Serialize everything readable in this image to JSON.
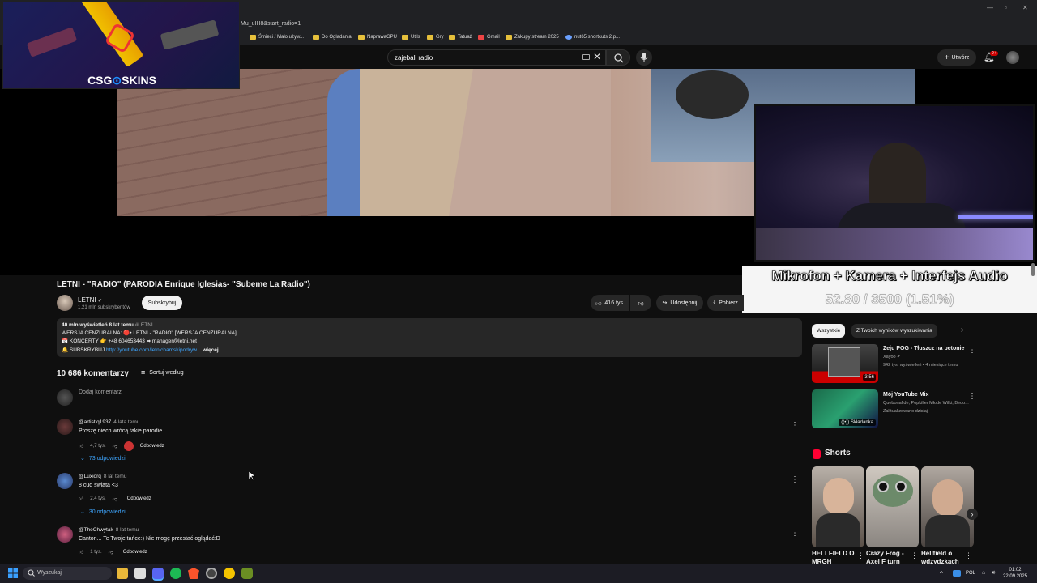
{
  "browser": {
    "address": "Mu_uIH8&start_radio=1",
    "bookmarks": [
      "Śmieci / Mało używ...",
      "Do Oglądania",
      "NaprawaGPU",
      "Utils",
      "Gry",
      "Tatuaż",
      "Gmail",
      "Zakupy stream 2025",
      "nut65 shortcuts 2.p..."
    ]
  },
  "youtube": {
    "search_value": "zajebali radio",
    "create_label": "Utwórz",
    "notification_badge": "9+"
  },
  "overlays": {
    "sponsor_brand": "CSG",
    "sponsor_brand_2": "SKINS",
    "promo_line1": "Mikrofon + Kamera + Interfejs Audio",
    "promo_line2": "52.80 / 3500 (1.51%)"
  },
  "video": {
    "title": "LETNI - \"RADIO\" (PARODIA Enrique Iglesias- \"Subeme La Radio\")",
    "channel": "LETNI",
    "subscribers": "1,21 mln subskrybentów",
    "subscribe_label": "Subskrybuj",
    "likes": "416 tys.",
    "share_label": "Udostępnij",
    "download_label": "Pobierz",
    "desc_stats": "40 mln wyświetleń  8 lat temu",
    "desc_tag": "#LETNI",
    "desc_line2": "WERSJA CENZURALNA: 🔴• LETNI - \"RADIO\" [WERSJA CENZURALNA]",
    "desc_line3": "📅 KONCERTY 👉 +48 604653443 ➡ manager@letni.net",
    "desc_line4_prefix": "🔔 SUBSKRYBUJ",
    "desc_link": "http://youtube.com/letnichamskipodryw",
    "desc_more": "...więcej"
  },
  "comments": {
    "count": "10 686 komentarzy",
    "sort_label": "Sortuj według",
    "add_placeholder": "Dodaj komentarz",
    "reply_label": "Odpowiedz",
    "items": [
      {
        "author": "@artistiq1937",
        "time": "4 lata temu",
        "text": "Proszę niech wrócą takie parodie",
        "likes": "4,7 tys.",
        "replies": "73 odpowiedzi"
      },
      {
        "author": "@Luxiorq",
        "time": "8 lat temu",
        "text": "8 cud świata <3",
        "likes": "2,4 tys.",
        "replies": "30 odpowiedzi"
      },
      {
        "author": "@TheChwytak",
        "time": "8 lat temu",
        "text": "Canton... Te Twoje tańce:) Nie mogę przestać oglądać:D",
        "likes": "1 tys.",
        "replies": ""
      }
    ]
  },
  "sidebar": {
    "chips": [
      "Wszystkie",
      "Z Twoich wyników wyszukiwania"
    ],
    "recommendations": [
      {
        "title": "Zeju POG - Tłuszcz na betonie",
        "channel": "Xayoo",
        "meta": "942 tys. wyświetleń • 4 miesiące temu",
        "duration": "3:56"
      },
      {
        "title": "Mój YouTube Mix",
        "channel": "Quebonafide, Popkiller Młode Wilki, Bedo...",
        "meta": "Zaktualizowano dzisiaj",
        "badge": "Składanka"
      }
    ],
    "shorts_heading": "Shorts",
    "shorts": [
      {
        "title": "HELLFIELD O MRGH"
      },
      {
        "title": "Crazy Frog - Axel F turn"
      },
      {
        "title": "Hellfield o wdzydzkach"
      }
    ]
  },
  "taskbar": {
    "search_placeholder": "Wyszukaj",
    "lang": "POL",
    "time": "01:02",
    "date": "22.09.2025"
  }
}
